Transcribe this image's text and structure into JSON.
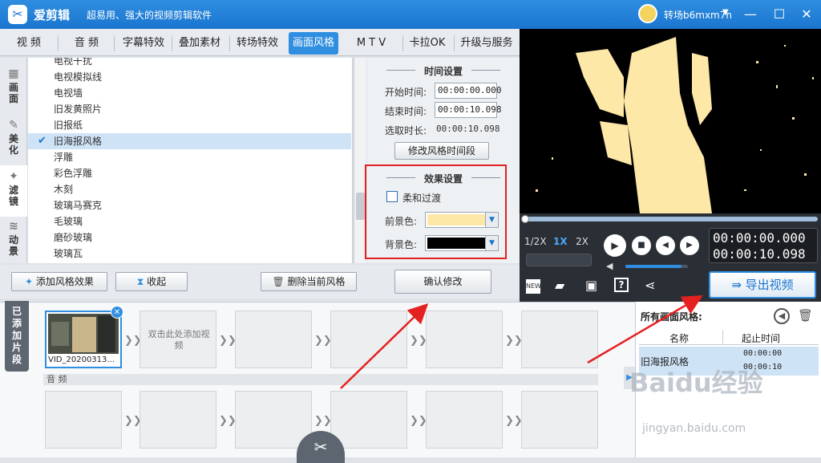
{
  "app": {
    "logo_glyph": "✂",
    "name": "爱剪辑",
    "slogan": "超易用、强大的视频剪辑软件",
    "user": "转场b6mxm7n",
    "user_caret": "▼",
    "min_glyph": "—",
    "max_glyph": "☐",
    "close_glyph": "✕"
  },
  "tabs": [
    "视 频",
    "音 频",
    "字幕特效",
    "叠加素材",
    "转场特效",
    "画面风格",
    "M T V",
    "卡拉OK",
    "升级与服务"
  ],
  "side_tabs": [
    {
      "icon": "grid-icon",
      "glyph": "▦",
      "label": "画面"
    },
    {
      "icon": "brush-icon",
      "glyph": "✎",
      "label": "美化"
    },
    {
      "icon": "magic-wand-icon",
      "glyph": "✦",
      "label": "滤镜"
    },
    {
      "icon": "wave-icon",
      "glyph": "≋",
      "label": "动景"
    }
  ],
  "style_list": {
    "items": [
      "电视干扰",
      "电视模拟线",
      "电视墙",
      "旧发黄照片",
      "旧报纸",
      "旧海报风格",
      "浮雕",
      "彩色浮雕",
      "木刻",
      "玻璃马赛克",
      "毛玻璃",
      "磨砂玻璃",
      "玻璃瓦"
    ],
    "selected": "旧海报风格",
    "check_glyph": "✔"
  },
  "time_settings": {
    "title": "时间设置",
    "start_label": "开始时间:",
    "start_value": "00:00:00.000",
    "end_label": "结束时间:",
    "end_value": "00:00:10.098",
    "duration_label": "选取时长:",
    "duration_value": "00:00:10.098",
    "modify_button": "修改风格时间段"
  },
  "effect_settings": {
    "title": "效果设置",
    "soft_transition_label": "柔和过渡",
    "soft_transition_checked": false,
    "fg_label": "前景色:",
    "fg_color": "#fde8a8",
    "bg_label": "背景色:",
    "bg_color": "#000000",
    "dropdown_glyph": "▼"
  },
  "actions": {
    "add_effect": "添加风格效果",
    "collapse": "收起",
    "delete_style": "删除当前风格",
    "confirm": "确认修改"
  },
  "player": {
    "speeds": [
      "1/2X",
      "1X",
      "2X"
    ],
    "active_speed": "1X",
    "current_time": "00:00:00.000",
    "total_time": "00:00:10.098",
    "progress": 0,
    "volume": 0.9,
    "export_button": "导出视频"
  },
  "timeline": {
    "added_label": "已添加片段",
    "clip_name": "VID_20200313...",
    "empty_slot_text": "双击此处添加视频",
    "audio_label": "音 频",
    "arrow_glyph": "❯❯"
  },
  "style_panel": {
    "title": "所有画面风格:",
    "col_name": "名称",
    "col_time": "起止时间",
    "row_name": "旧海报风格",
    "row_start": "00:00:00",
    "row_end": "00:00:10"
  },
  "watermark": {
    "brand": "Baidu经验",
    "url": "jingyan.baidu.com"
  },
  "colors": {
    "accent": "#2f8ee0",
    "annotation": "#e52020",
    "poster_light": "#fde8a8"
  }
}
